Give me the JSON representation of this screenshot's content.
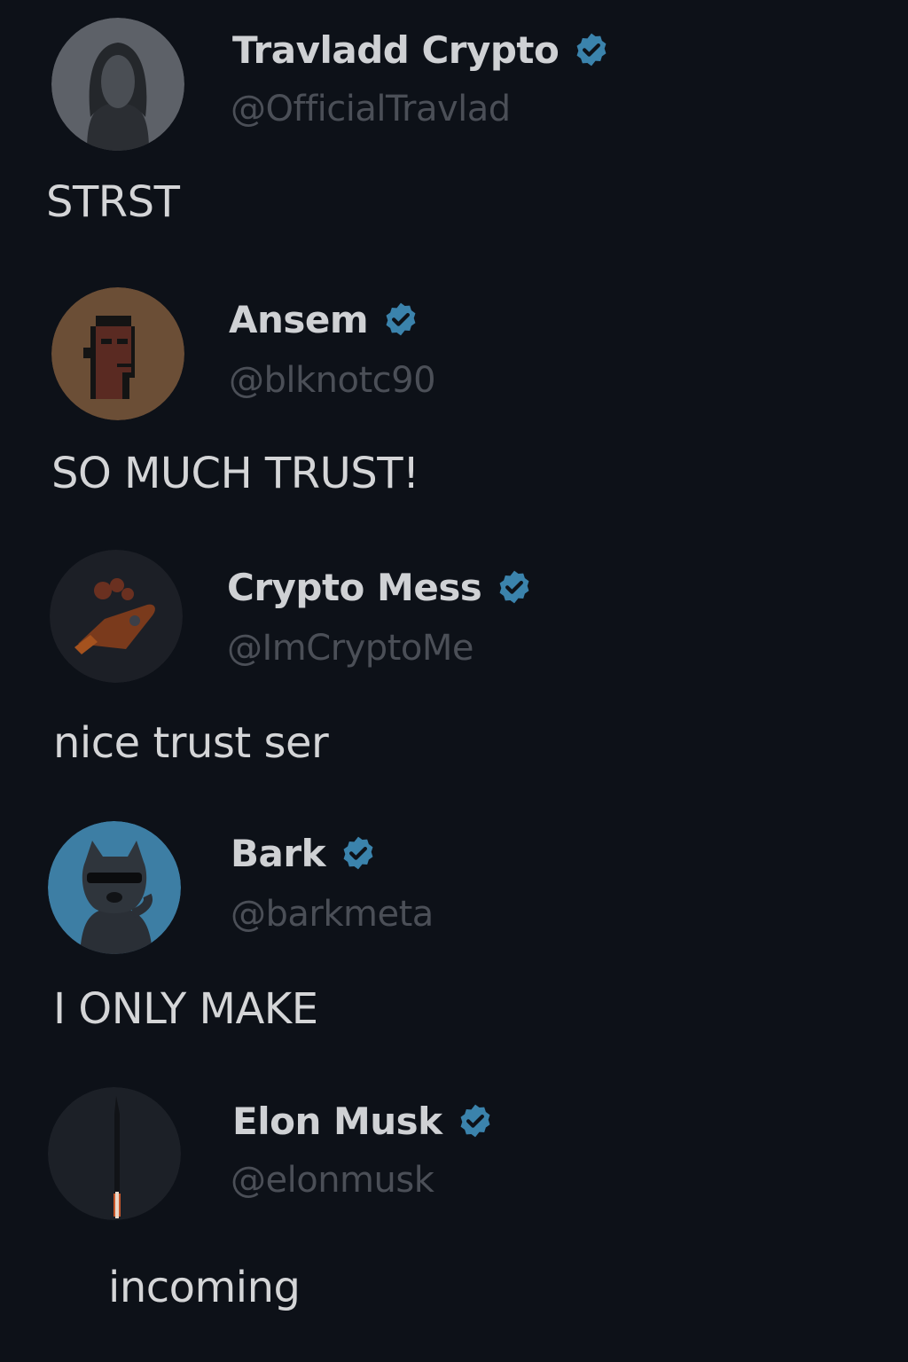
{
  "colors": {
    "background": "#0d1118",
    "verified_badge": "#3b83ac",
    "name": "#cfd1d4",
    "handle": "#4b4f57",
    "message": "#d4d5d7"
  },
  "posts": [
    {
      "display_name": "Travladd Crypto",
      "handle": "@OfficialTravlad",
      "message": "STRST",
      "avatar_icon": "hooded-figure-avatar",
      "verified": true
    },
    {
      "display_name": "Ansem",
      "handle": "@blknotc90",
      "message": "SO MUCH TRUST!",
      "avatar_icon": "pixel-punk-avatar",
      "verified": true
    },
    {
      "display_name": "Crypto Mess",
      "handle": "@ImCryptoMe",
      "message": "nice trust ser",
      "avatar_icon": "rocket-avatar",
      "verified": true
    },
    {
      "display_name": "Bark",
      "handle": "@barkmeta",
      "message": "I ONLY MAKE",
      "avatar_icon": "sunglasses-dog-avatar",
      "verified": true
    },
    {
      "display_name": "Elon Musk",
      "handle": "@elonmusk",
      "message": "incoming",
      "avatar_icon": "rocket-launch-avatar",
      "verified": true
    }
  ]
}
